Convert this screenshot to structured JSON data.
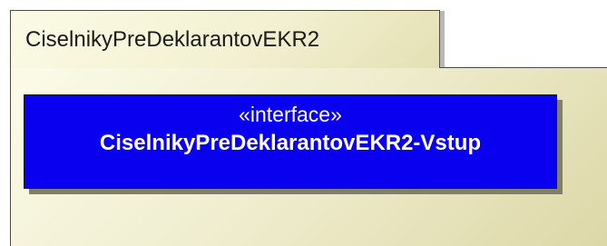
{
  "package": {
    "name": "CiselnikyPreDeklarantovEKR2",
    "fill_color": "#f3f1d2"
  },
  "interface": {
    "stereotype": "«interface»",
    "name": "CiselnikyPreDeklarantovEKR2-Vstup",
    "fill_color": "#0a00f0",
    "text_color": "#ffffff"
  }
}
